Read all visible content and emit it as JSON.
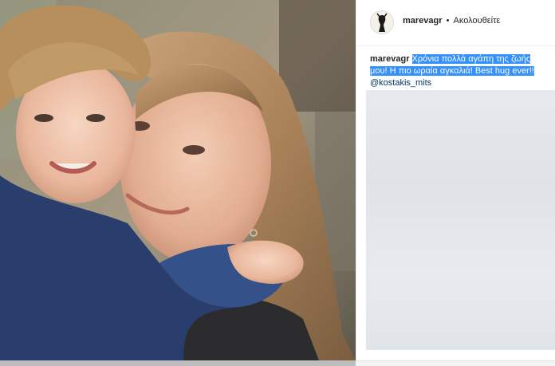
{
  "header": {
    "username": "marevagr",
    "separator": "•",
    "follow_label": "Ακολουθείτε"
  },
  "caption": {
    "username": "marevagr",
    "text_line1": "Χρόνια πολλά αγάπη της ζωής",
    "text_line2": "μου! Η πιο ωραία αγκαλιά! Best hug ever!!",
    "mention": "@kostakis_mits"
  },
  "colors": {
    "selection_highlight": "#3390ff",
    "mention_link": "#003569",
    "text": "#262626"
  },
  "icons": {
    "avatar": "profile-avatar"
  }
}
